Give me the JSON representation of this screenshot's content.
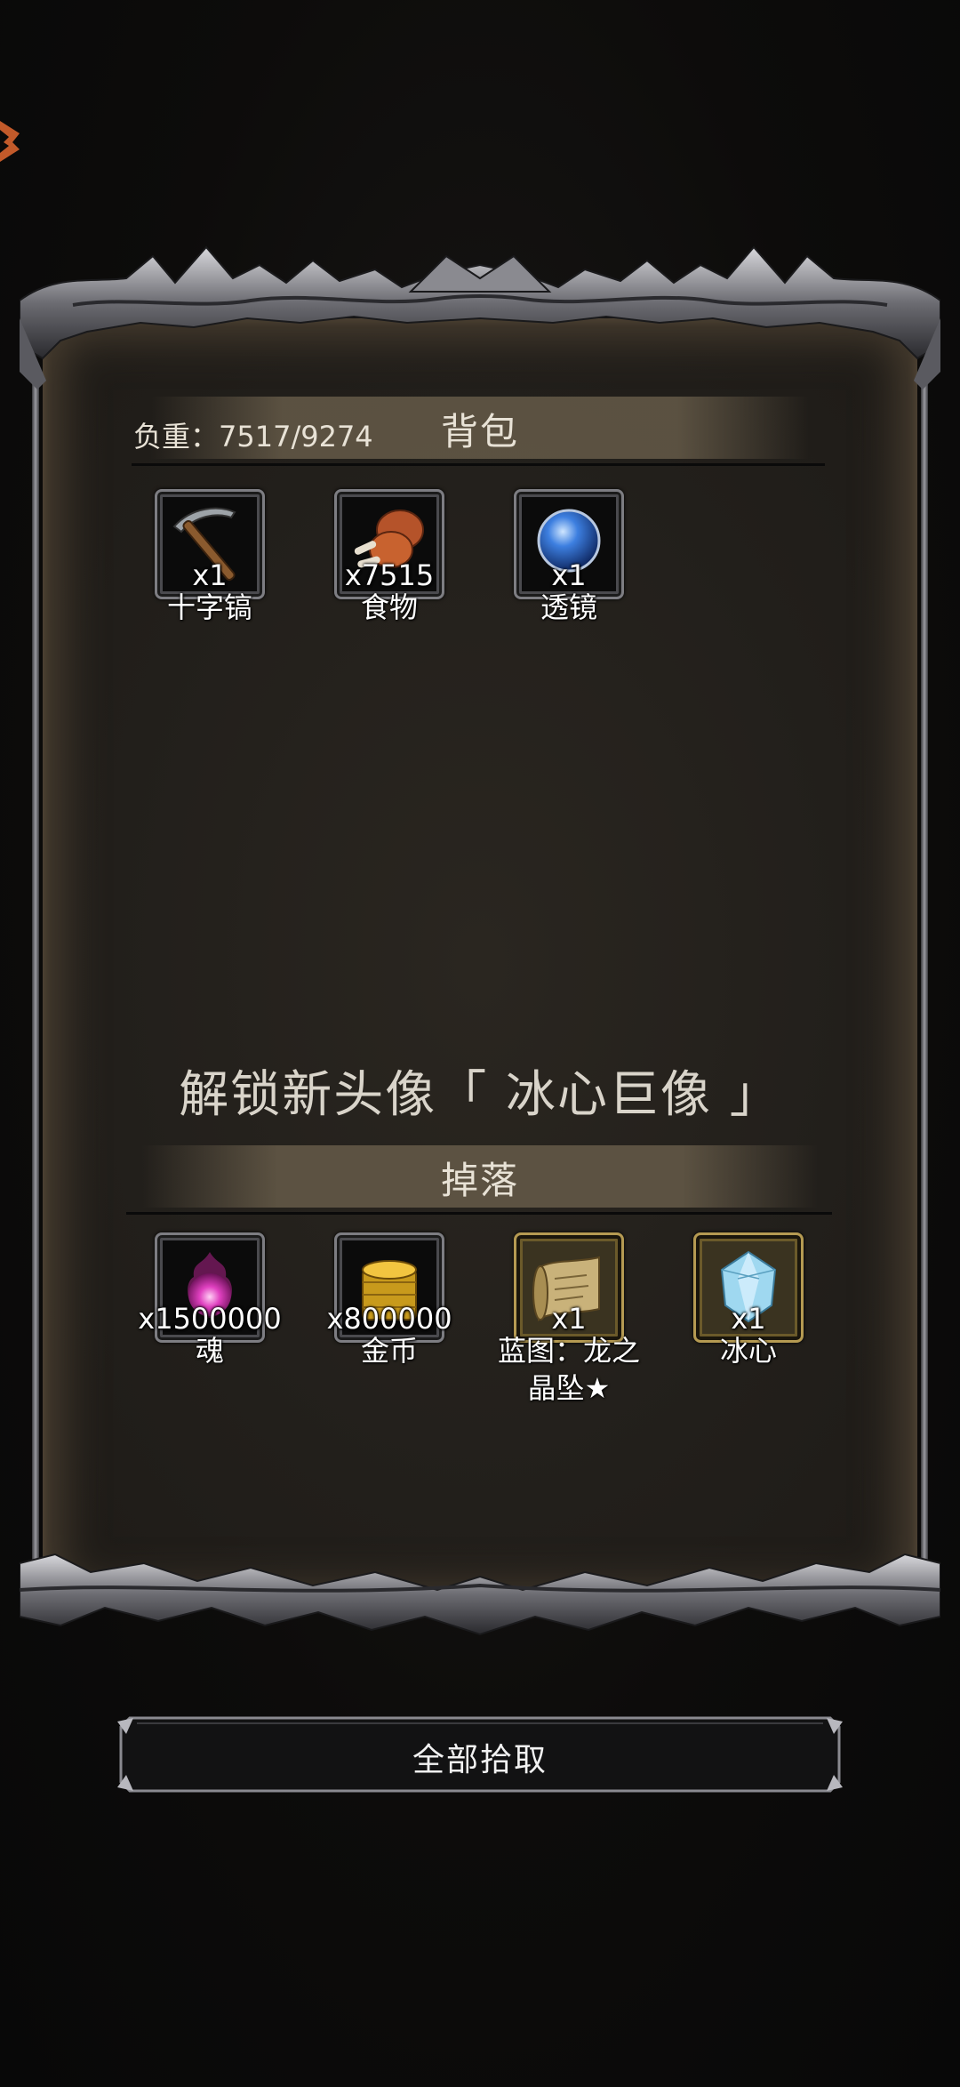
{
  "inventory": {
    "weight_label": "负重：7517/9274",
    "title": "背包",
    "items": [
      {
        "icon": "pickaxe-icon",
        "count": "x1",
        "name": "十字镐"
      },
      {
        "icon": "meat-icon",
        "count": "x7515",
        "name": "食物"
      },
      {
        "icon": "lens-orb-icon",
        "count": "x1",
        "name": "透镜"
      }
    ]
  },
  "unlock_text": "解锁新头像「 冰心巨像 」",
  "drops": {
    "title": "掉落",
    "items": [
      {
        "icon": "soul-orb-icon",
        "count": "x1500000",
        "name": "魂",
        "rare": false
      },
      {
        "icon": "gold-coins-icon",
        "count": "x800000",
        "name": "金币",
        "rare": false
      },
      {
        "icon": "blueprint-scroll-icon",
        "count": "x1",
        "name": "蓝图：龙之晶坠★",
        "rare": true
      },
      {
        "icon": "ice-crystal-icon",
        "count": "x1",
        "name": "冰心",
        "rare": true
      }
    ]
  },
  "pick_all_label": "全部拾取",
  "colors": {
    "background": "#0b0b0b",
    "parchment": "#221f1b",
    "frame_metal": "#9a9aa0",
    "rare_border": "#b59a52",
    "text": "#ffffff"
  }
}
